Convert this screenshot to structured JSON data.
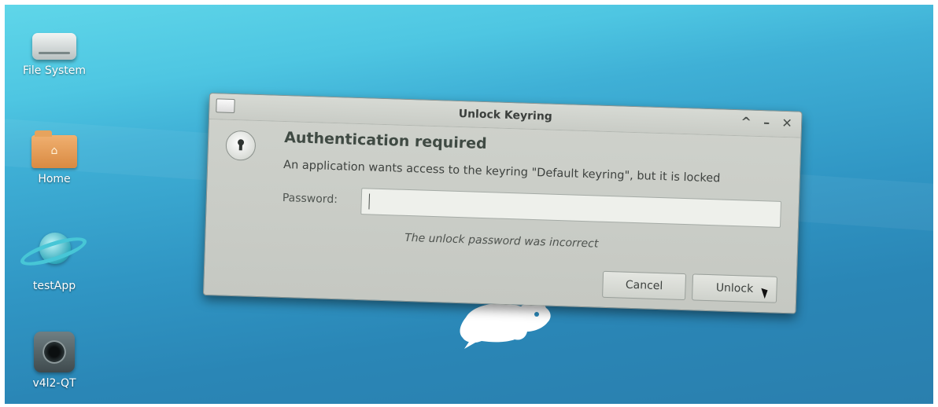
{
  "desktop": {
    "icons": [
      {
        "label": "File System",
        "icon": "drive-icon"
      },
      {
        "label": "Home",
        "icon": "home-folder-icon",
        "glyph": "⌂"
      },
      {
        "label": "testApp",
        "icon": "app-orbit-icon"
      },
      {
        "label": "v4l2-QT",
        "icon": "camera-icon"
      }
    ]
  },
  "dialog": {
    "title": "Unlock Keyring",
    "controls": {
      "maximize": "^",
      "minimize": "–",
      "close": "✕"
    },
    "heading": "Authentication required",
    "message": "An application wants access to the keyring \"Default keyring\", but it is locked",
    "password_label": "Password:",
    "password_value": "",
    "error": "The unlock password was incorrect",
    "cancel_label": "Cancel",
    "unlock_label": "Unlock"
  },
  "colors": {
    "desktop_top": "#5fd6e9",
    "desktop_bottom": "#2a7fae",
    "dialog_bg": "#cfd2cc",
    "heading": "#3f4a43"
  }
}
